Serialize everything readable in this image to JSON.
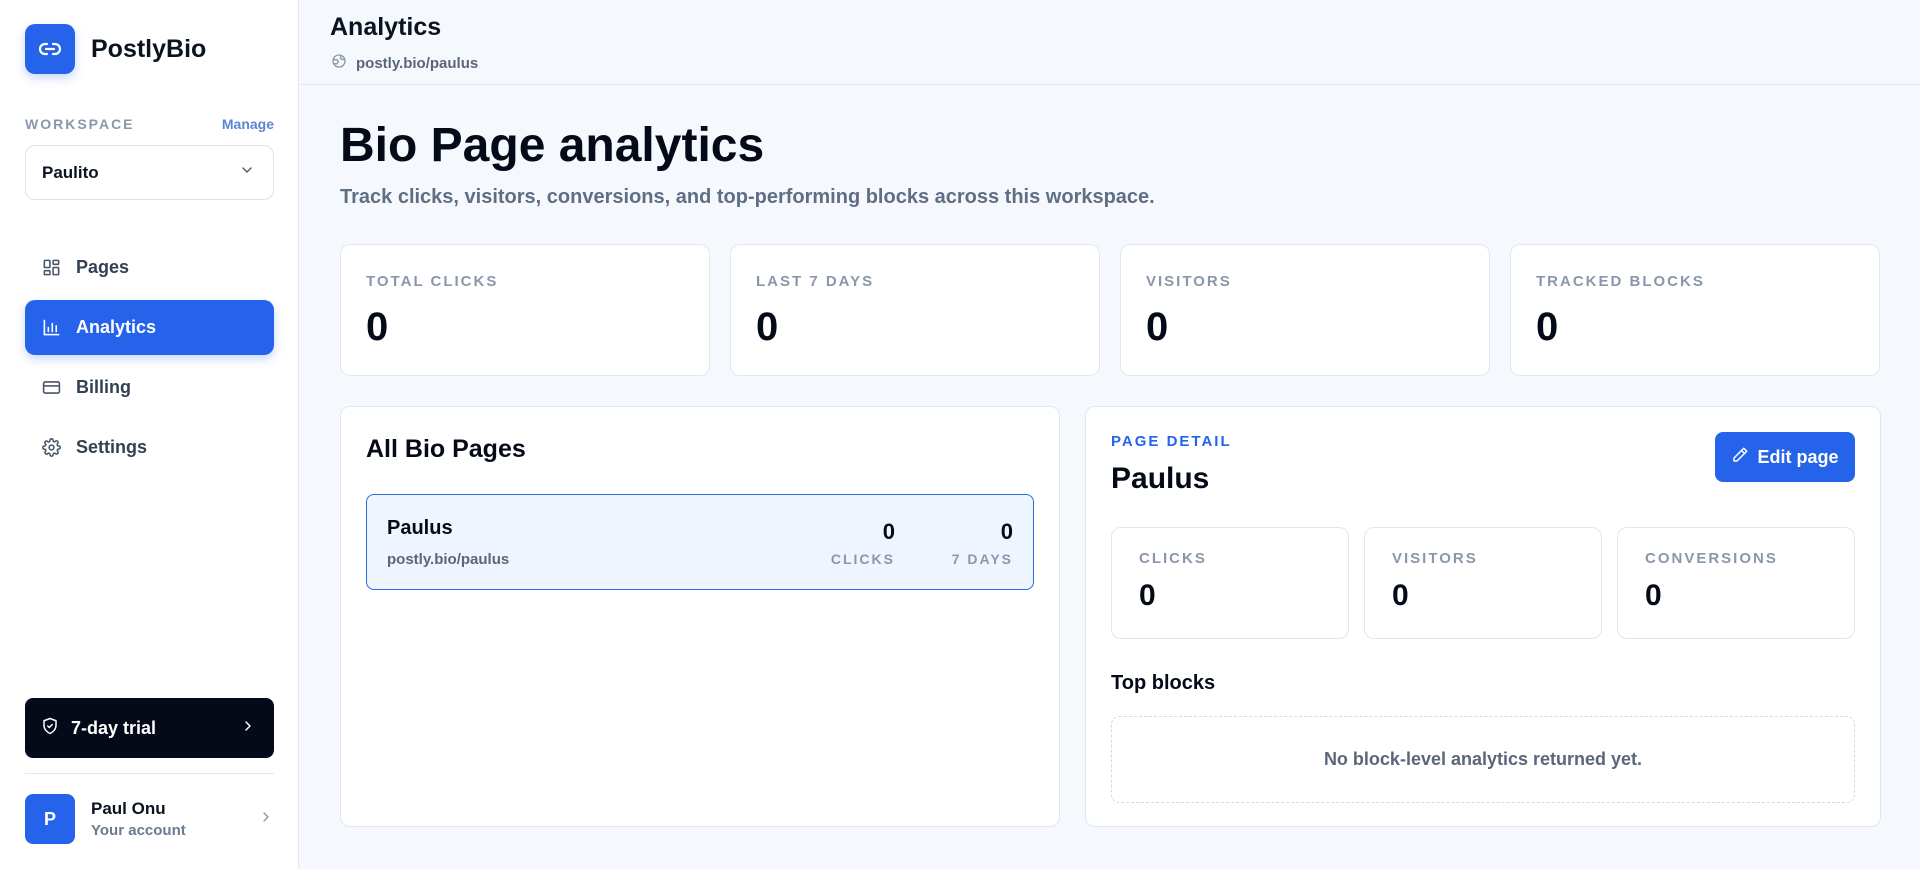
{
  "brand": {
    "name": "PostlyBio"
  },
  "workspace": {
    "label": "WORKSPACE",
    "manage_label": "Manage",
    "selected": "Paulito"
  },
  "nav": [
    {
      "label": "Pages",
      "icon": "grid-icon"
    },
    {
      "label": "Analytics",
      "icon": "bar-chart-icon",
      "active": true
    },
    {
      "label": "Billing",
      "icon": "credit-card-icon"
    },
    {
      "label": "Settings",
      "icon": "gear-icon"
    }
  ],
  "trial": {
    "label": "7-day trial"
  },
  "account": {
    "initial": "P",
    "name": "Paul Onu",
    "subtitle": "Your account"
  },
  "header": {
    "title": "Analytics",
    "url": "postly.bio/paulus"
  },
  "main": {
    "title": "Bio Page analytics",
    "subtitle": "Track clicks, visitors, conversions, and top-performing blocks across this workspace.",
    "stats": [
      {
        "label": "TOTAL CLICKS",
        "value": "0"
      },
      {
        "label": "LAST 7 DAYS",
        "value": "0"
      },
      {
        "label": "VISITORS",
        "value": "0"
      },
      {
        "label": "TRACKED BLOCKS",
        "value": "0"
      }
    ]
  },
  "bio_pages": {
    "title": "All Bio Pages",
    "rows": [
      {
        "name": "Paulus",
        "url": "postly.bio/paulus",
        "clicks": "0",
        "clicks_label": "CLICKS",
        "seven_days": "0",
        "seven_days_label": "7 DAYS"
      }
    ]
  },
  "page_detail": {
    "kicker": "PAGE DETAIL",
    "title": "Paulus",
    "edit_label": "Edit page",
    "metrics": [
      {
        "label": "CLICKS",
        "value": "0"
      },
      {
        "label": "VISITORS",
        "value": "0"
      },
      {
        "label": "CONVERSIONS",
        "value": "0"
      }
    ],
    "top_blocks_title": "Top blocks",
    "top_blocks_empty": "No block-level analytics returned yet."
  },
  "colors": {
    "accent": "#2563eb",
    "dark": "#050a18",
    "muted": "#8a97ab"
  }
}
